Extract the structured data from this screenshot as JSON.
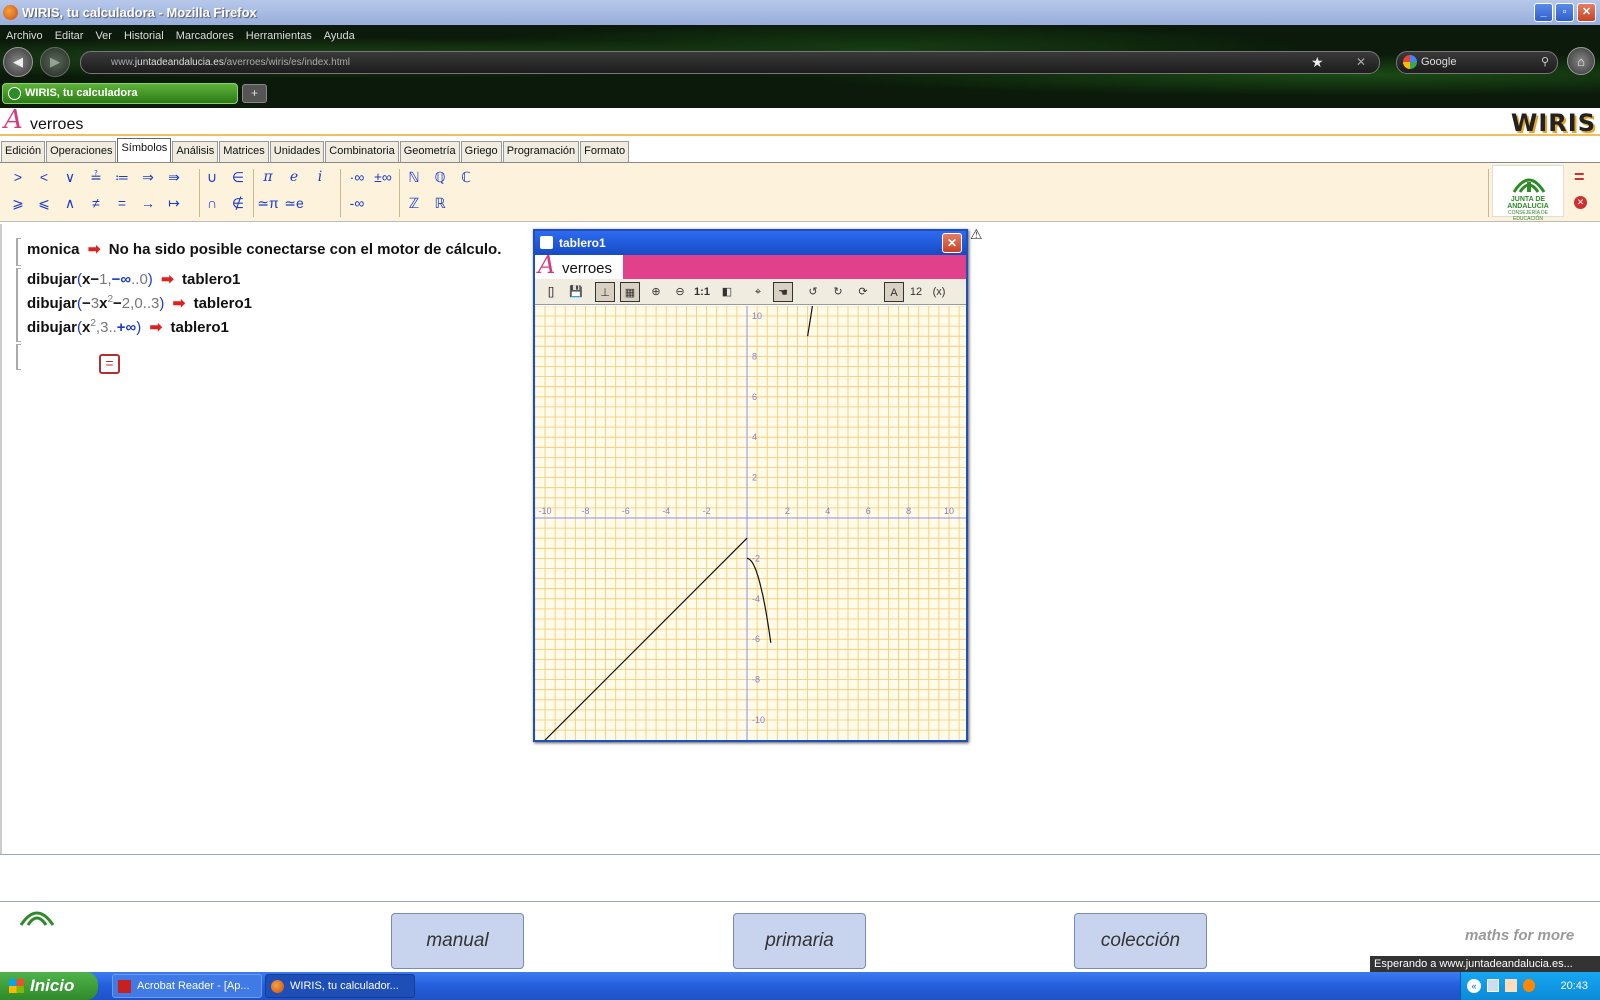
{
  "window": {
    "title": "WIRIS, tu calculadora - Mozilla Firefox"
  },
  "menu": [
    "Archivo",
    "Editar",
    "Ver",
    "Historial",
    "Marcadores",
    "Herramientas",
    "Ayuda"
  ],
  "url": {
    "prefix": "www.",
    "domain": "juntadeandalucia.es",
    "path": "/averroes/wiris/es/index.html"
  },
  "search": {
    "engine": "Google"
  },
  "browser_tab": {
    "label": "WIRIS, tu calculadora"
  },
  "app": {
    "logo_letter": "A",
    "logo_text": "verroes",
    "brand": "WIRIS"
  },
  "tabs": [
    {
      "label": "Edición"
    },
    {
      "label": "Operaciones"
    },
    {
      "label": "Símbolos",
      "active": true
    },
    {
      "label": "Análisis"
    },
    {
      "label": "Matrices"
    },
    {
      "label": "Unidades"
    },
    {
      "label": "Combinatoria"
    },
    {
      "label": "Geometría"
    },
    {
      "label": "Griego"
    },
    {
      "label": "Programación"
    },
    {
      "label": "Formato"
    }
  ],
  "palette": {
    "row1": [
      ">",
      "<",
      "∨",
      "≟",
      "≔",
      "⇒",
      "⇛",
      "∪",
      "∈",
      "π",
      "e",
      "i",
      "·∞",
      "±∞",
      "ℕ",
      "ℚ",
      "ℂ"
    ],
    "row2": [
      "⩾",
      "⩽",
      "∧",
      "≠",
      "=",
      "→",
      "↦",
      "∩",
      "∉",
      "≃π",
      "≃e",
      "-∞",
      "ℤ",
      "ℝ"
    ],
    "logo": {
      "line1": "JUNTA DE ANDALUCIA",
      "line2": "CONSEJERÍA DE EDUCACIÓN"
    }
  },
  "worksheet": {
    "line1": {
      "input": "monica",
      "result": "No ha sido posible conectarse con el motor de cálculo."
    },
    "line2": {
      "fn": "dibujar",
      "a": "x",
      "b": "−",
      "c": "1",
      "d": ",",
      "e": "−∞",
      "f": "..",
      "g": "0",
      "result": "tablero1"
    },
    "line3": {
      "fn": "dibujar",
      "a": "−",
      "b": "3",
      "c": "x",
      "exp": "2",
      "d": "−",
      "e": "2",
      "f": ",",
      "g": "0",
      "h": "..",
      "i": "3",
      "result": "tablero1"
    },
    "line4": {
      "fn": "dibujar",
      "a": "x",
      "exp": "2",
      "b": ",",
      "c": "3",
      "d": "..",
      "e": "+∞",
      "result": "tablero1"
    },
    "calc_button": "="
  },
  "graph": {
    "title": "tablero1",
    "header_letter": "A",
    "header_text": "verroes",
    "toolbar": [
      "save-icon",
      "axes-icon",
      "grid-icon",
      "zoom-in-icon",
      "zoom-out-icon",
      "1:1",
      "contrast-icon",
      "target-icon",
      "hand-icon",
      "rotate-left-icon",
      "rotate-right-icon",
      "refresh-icon",
      "label-icon",
      "numbers-icon",
      "coords-icon"
    ],
    "zoom_label": "1:1",
    "x_ticks": [
      "-10",
      "-8",
      "-6",
      "-4",
      "-2",
      "2",
      "4",
      "6",
      "8",
      "10"
    ],
    "y_ticks": [
      "10",
      "8",
      "6",
      "4",
      "2",
      "-2",
      "-4",
      "-6",
      "-8",
      "-10"
    ]
  },
  "footer": {
    "buttons": [
      "manual",
      "primaria",
      "colección"
    ],
    "brand": "maths for more",
    "status": "Esperando a www.juntadeandalucia.es..."
  },
  "taskbar": {
    "start": "Inicio",
    "tasks": [
      {
        "label": "Acrobat Reader - [Ap..."
      },
      {
        "label": "WIRIS, tu calculador..."
      }
    ],
    "time": "20:43"
  }
}
